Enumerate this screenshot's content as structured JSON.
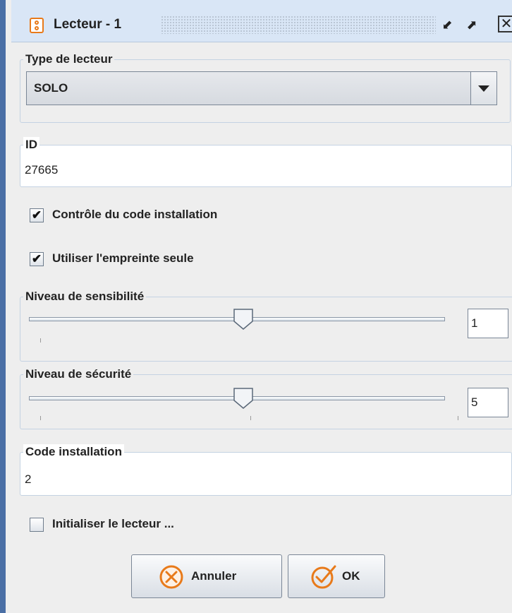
{
  "window": {
    "title": "Lecteur - 1",
    "restore_icon": "restore-down-icon",
    "maximize_icon": "maximize-icon",
    "close_icon": "close-icon",
    "close_glyph": "✕",
    "restore_glyph": "⬋",
    "maximize_glyph": "⬈"
  },
  "type_lecteur": {
    "label": "Type de lecteur",
    "value": "SOLO"
  },
  "id_field": {
    "label": "ID",
    "value": "27665"
  },
  "checkboxes": {
    "controle_code": {
      "label": "Contrôle du code installation",
      "checked": true,
      "mark": "✔"
    },
    "empreinte_seule": {
      "label": "Utiliser l'empreinte seule",
      "checked": true,
      "mark": "✔"
    },
    "initialiser": {
      "label": "Initialiser le lecteur ...",
      "checked": false,
      "mark": ""
    }
  },
  "sensibilite": {
    "label": "Niveau de sensibilité",
    "value": "1",
    "slider_fraction": 0.5
  },
  "securite": {
    "label": "Niveau de sécurité",
    "value": "5",
    "slider_fraction": 0.5
  },
  "code_installation": {
    "label": "Code installation",
    "value": "2"
  },
  "buttons": {
    "cancel": {
      "label": "Annuler",
      "icon": "cancel-x-icon"
    },
    "ok": {
      "label": "OK",
      "icon": "checkmark-icon"
    }
  },
  "colors": {
    "accent": "#e87a1a",
    "frame": "#4a6fa5",
    "titlebar": "#d9e6f6"
  }
}
